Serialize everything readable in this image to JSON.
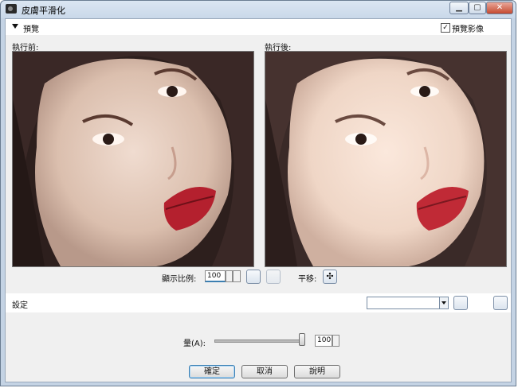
{
  "window": {
    "title": "皮膚平滑化"
  },
  "preview": {
    "section_label": "預覽",
    "show_preview_label": "預覽影像",
    "show_preview_checked": true,
    "before_label": "執行前:",
    "after_label": "執行後:",
    "zoom_label": "顯示比例:",
    "zoom_value": "100",
    "pan_label": "平移:"
  },
  "settings": {
    "label": "設定",
    "preset_value": ""
  },
  "amount": {
    "label": "量(A):",
    "value": "100",
    "slider_fraction": 1.0
  },
  "buttons": {
    "ok": "確定",
    "cancel": "取消",
    "help": "說明"
  },
  "colors": {
    "titlebar": "#c9d8e9",
    "panel_bg": "#f0f0f0",
    "accent": "#3c7fb1"
  }
}
